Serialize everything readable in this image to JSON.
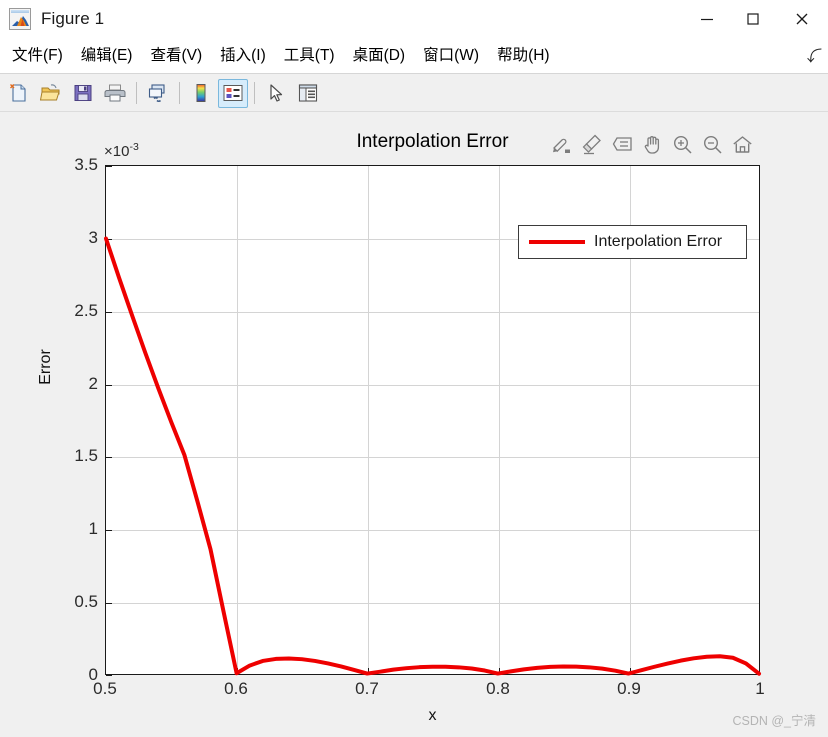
{
  "window": {
    "title": "Figure 1",
    "app_icon": "matlab-membrane-icon",
    "controls": {
      "minimize": "—",
      "maximize": "□",
      "close": "✕"
    }
  },
  "menubar": {
    "items": [
      {
        "label": "文件(F)",
        "name": "menu-file"
      },
      {
        "label": "编辑(E)",
        "name": "menu-edit"
      },
      {
        "label": "查看(V)",
        "name": "menu-view"
      },
      {
        "label": "插入(I)",
        "name": "menu-insert"
      },
      {
        "label": "工具(T)",
        "name": "menu-tools"
      },
      {
        "label": "桌面(D)",
        "name": "menu-desktop"
      },
      {
        "label": "窗口(W)",
        "name": "menu-window"
      },
      {
        "label": "帮助(H)",
        "name": "menu-help"
      }
    ],
    "overflow_glyph": "⤵"
  },
  "toolbar": {
    "buttons": [
      {
        "name": "new-figure-icon",
        "active": false
      },
      {
        "name": "open-file-icon",
        "active": false
      },
      {
        "name": "save-figure-icon",
        "active": false
      },
      {
        "name": "print-figure-icon",
        "active": false
      },
      {
        "name": "link-plot-icon",
        "active": false
      },
      {
        "name": "insert-colorbar-icon",
        "active": false
      },
      {
        "name": "insert-legend-icon",
        "active": true
      },
      {
        "name": "edit-plot-pointer-icon",
        "active": false
      },
      {
        "name": "plot-browser-icon",
        "active": false
      }
    ]
  },
  "axes_toolbar": {
    "buttons": [
      {
        "name": "export-save-icon"
      },
      {
        "name": "brush-data-icon"
      },
      {
        "name": "data-cursor-icon"
      },
      {
        "name": "pan-hand-icon"
      },
      {
        "name": "zoom-in-icon"
      },
      {
        "name": "zoom-out-icon"
      },
      {
        "name": "restore-home-icon"
      }
    ]
  },
  "watermark": "CSDN @_宁清",
  "chart_data": {
    "type": "line",
    "title": "Interpolation Error",
    "xlabel": "x",
    "ylabel": "Error",
    "y_exponent_label": "×10",
    "y_exponent_power": "-3",
    "xlim": [
      0.5,
      1.0
    ],
    "ylim": [
      0,
      3.5
    ],
    "xticks": [
      0.5,
      0.6,
      0.7,
      0.8,
      0.9,
      1
    ],
    "xtick_labels": [
      "0.5",
      "0.6",
      "0.7",
      "0.8",
      "0.9",
      "1"
    ],
    "yticks": [
      0,
      0.5,
      1,
      1.5,
      2,
      2.5,
      3,
      3.5
    ],
    "ytick_labels": [
      "0",
      "0.5",
      "1",
      "1.5",
      "2",
      "2.5",
      "3",
      "3.5"
    ],
    "grid": true,
    "legend_position": "north-east",
    "series": [
      {
        "name": "Interpolation Error",
        "color": "#ee0000",
        "linewidth": 4,
        "x": [
          0.5,
          0.51,
          0.52,
          0.53,
          0.54,
          0.55,
          0.56,
          0.57,
          0.58,
          0.59,
          0.6,
          0.61,
          0.62,
          0.63,
          0.64,
          0.65,
          0.66,
          0.67,
          0.68,
          0.69,
          0.7,
          0.71,
          0.72,
          0.73,
          0.74,
          0.75,
          0.76,
          0.77,
          0.78,
          0.79,
          0.8,
          0.81,
          0.82,
          0.83,
          0.84,
          0.85,
          0.86,
          0.87,
          0.88,
          0.89,
          0.9,
          0.91,
          0.92,
          0.93,
          0.94,
          0.95,
          0.96,
          0.97,
          0.98,
          0.99,
          1.0
        ],
        "y": [
          3.0,
          2.73,
          2.47,
          2.215,
          1.97,
          1.735,
          1.51,
          1.19,
          0.86,
          0.43,
          0.005,
          0.058,
          0.09,
          0.104,
          0.107,
          0.102,
          0.09,
          0.073,
          0.052,
          0.028,
          0.003,
          0.016,
          0.03,
          0.04,
          0.047,
          0.05,
          0.05,
          0.046,
          0.038,
          0.024,
          0.003,
          0.018,
          0.032,
          0.042,
          0.049,
          0.052,
          0.051,
          0.046,
          0.037,
          0.023,
          0.003,
          0.026,
          0.05,
          0.072,
          0.092,
          0.108,
          0.119,
          0.122,
          0.112,
          0.073,
          0.002
        ]
      }
    ]
  }
}
